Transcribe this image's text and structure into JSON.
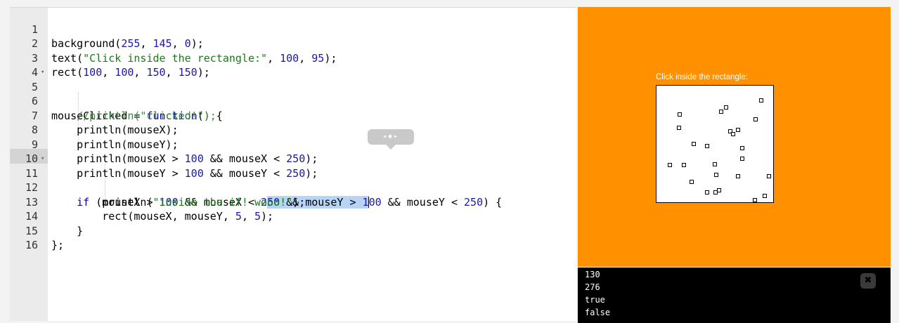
{
  "editor": {
    "lines": [
      {
        "num": "1",
        "code": "background(255, 145, 0);"
      },
      {
        "num": "2",
        "code": "text(\"Click inside the rectangle:\", 100, 95);"
      },
      {
        "num": "3",
        "code": "rect(100, 100, 150, 150);"
      },
      {
        "num": "4",
        "code": ""
      },
      {
        "num": "5",
        "code": "mouseClicked = function() {"
      },
      {
        "num": "6",
        "code": "//println(\"clicked!\");"
      },
      {
        "num": "7",
        "code": "println(mouseX);"
      },
      {
        "num": "8",
        "code": "println(mouseY);"
      },
      {
        "num": "9",
        "code": "println(mouseX > 100 && mouseX < 250);"
      },
      {
        "num": "10",
        "code": "println(mouseY > 100 && mouseY < 250);"
      },
      {
        "num": "11",
        "code": "if (mouseX > 100 && mouseX < 250 && mouseY > 100 && mouseY < 250) {"
      },
      {
        "num": "12",
        "code": "println(\"inside the if! wooo!\");"
      },
      {
        "num": "13",
        "code": "rect(mouseX, mouseY, 5, 5);"
      },
      {
        "num": "14",
        "code": "}"
      },
      {
        "num": "15",
        "code": "};"
      },
      {
        "num": "16",
        "code": ""
      }
    ],
    "fold_marker": "▾",
    "number_scrubber_glyph": "◂◆▸"
  },
  "canvas": {
    "caption": "Click inside the rectangle:",
    "background_color": "#ff9100"
  },
  "console": {
    "lines": [
      "130",
      "276",
      "true",
      "false"
    ],
    "close_icon": "✖"
  },
  "colors": {
    "number": "#1c17a6",
    "string": "#1a7a1a",
    "comment": "#3e8a3e",
    "selection": "#b7d3f5"
  }
}
